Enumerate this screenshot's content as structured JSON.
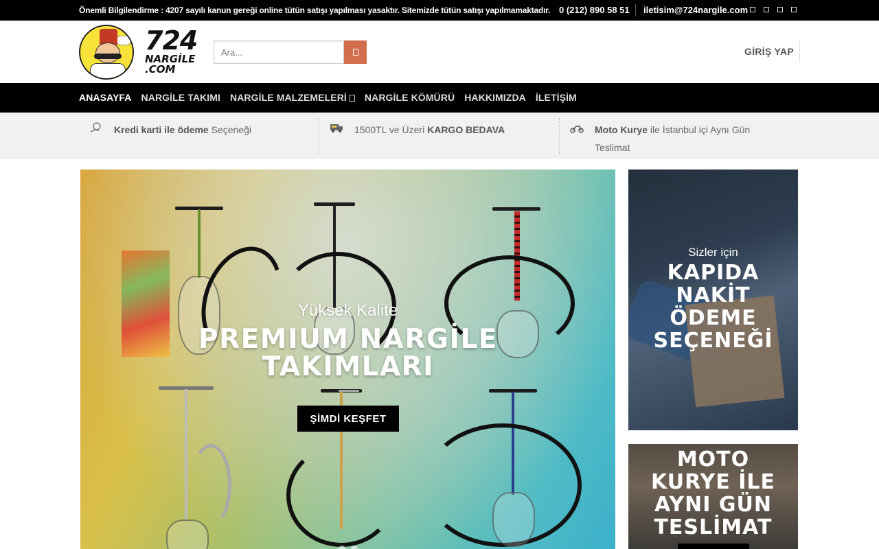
{
  "topbar": {
    "notice": "Önemli Bilgilendirme : 4207 sayılı kanun gereği online tütün satışı yapılması yasaktır. Sitemizde tütün satışı yapılmamaktadır.",
    "phone": "0 (212) 890 58 51",
    "email": "iletisim@724nargile.com",
    "social_icons": [
      "facebook-icon",
      "instagram-icon",
      "twitter-icon",
      "whatsapp-icon"
    ]
  },
  "header": {
    "logo_text_1": "724",
    "logo_text_2": "NARGİLE",
    "logo_text_3": ".COM",
    "search_placeholder": "Ara...",
    "login_label": "GİRİŞ YAP"
  },
  "nav": {
    "items": [
      {
        "label": "ANASAYFA",
        "active": true
      },
      {
        "label": "NARGİLE TAKIMI"
      },
      {
        "label": "NARGİLE MALZEMELERİ",
        "has_dropdown": true
      },
      {
        "label": "NARGİLE KÖMÜRÜ"
      },
      {
        "label": "HAKKIMIZDA"
      },
      {
        "label": "İLETİŞİM"
      }
    ]
  },
  "info": {
    "item1_bold": "Kredi karti ile ödeme",
    "item1_rest": " Seçeneği",
    "item2_pre": "1500TL ve Üzeri ",
    "item2_bold": "KARGO BEDAVA",
    "item3_bold": "Moto Kurye",
    "item3_rest": " ile İstanbul içi Aynı Gün",
    "item3_line2": "Teslimat"
  },
  "hero": {
    "subtitle": "Yüksek Kalite",
    "title": "PREMIUM NARGİLE TAKIMLARI",
    "cta_label": "ŞİMDİ KEŞFET",
    "slide_count": 2,
    "active_slide": 1
  },
  "side_banner_1": {
    "subtitle": "Sizler için",
    "title": "KAPIDA NAKİT ÖDEME SEÇENEĞİ"
  },
  "side_banner_2": {
    "title": "MOTO KURYE İLE AYNI GÜN TESLİMAT"
  },
  "colors": {
    "accent": "#d26e4b",
    "topbar_bg": "#000000",
    "nav_bg": "#000000",
    "info_bg": "#f1f1f1"
  }
}
